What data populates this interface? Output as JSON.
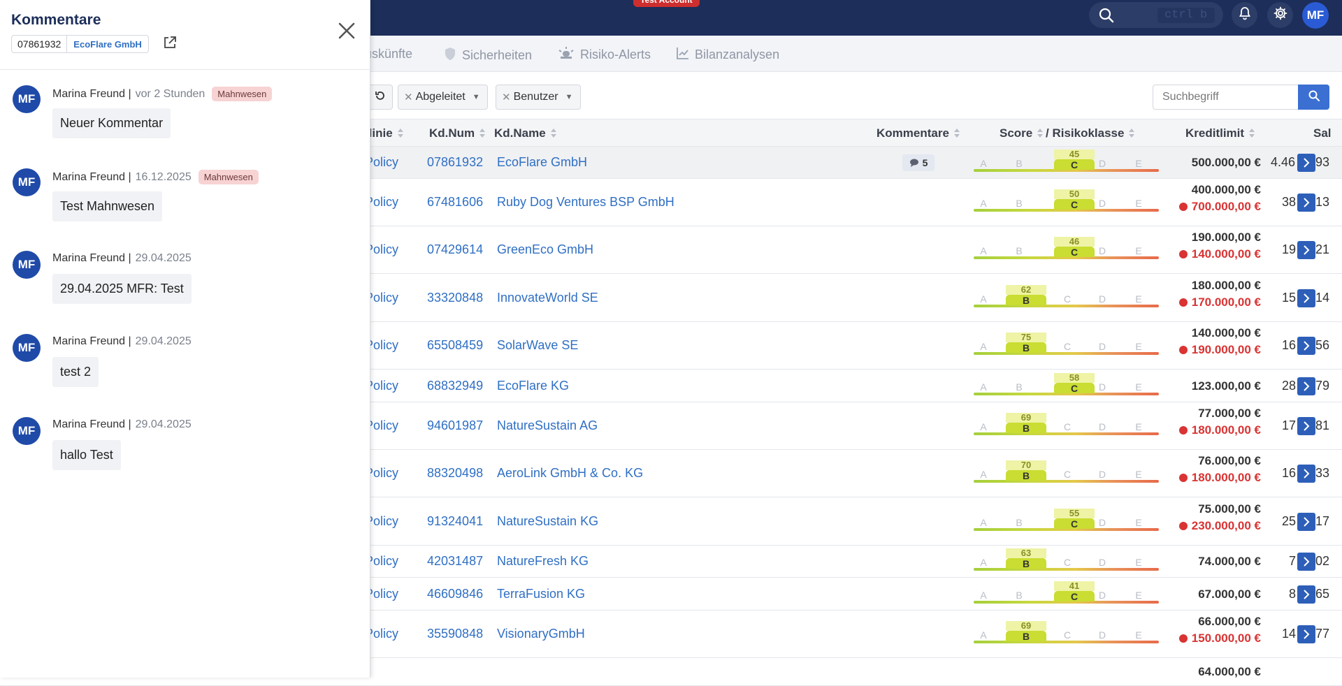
{
  "topbar": {
    "test_badge": "Test Account",
    "search_shortcut": "ctrl  b",
    "user_initials": "MF"
  },
  "subnav": {
    "items": [
      {
        "label": "uskünfte",
        "icon": "document-icon"
      },
      {
        "label": "Sicherheiten",
        "icon": "shield-icon"
      },
      {
        "label": "Risiko-Alerts",
        "icon": "alarm-icon"
      },
      {
        "label": "Bilanzanalysen",
        "icon": "chart-line-icon"
      }
    ]
  },
  "filters": {
    "chips": [
      "Abgeleitet",
      "Benutzer"
    ],
    "search_placeholder": "Suchbegriff"
  },
  "table": {
    "headers": {
      "richtlinie": "tlinie",
      "kdnum": "Kd.Num",
      "kdname": "Kd.Name",
      "kommentare": "Kommentare",
      "score": "Score",
      "risikoklasse": "/ Risikoklasse",
      "kreditlimit": "Kreditlimit",
      "saldo": "Sal"
    },
    "rows": [
      {
        "policy": "Policy",
        "kdnum": "07861932",
        "kdname": "EcoFlare GmbH",
        "comments": "5",
        "score": 45,
        "class": "C",
        "limit": "500.000,00 €",
        "limit_red": "",
        "saldo": "4.46",
        "saldo_tail": "93"
      },
      {
        "policy": "Policy",
        "kdnum": "67481606",
        "kdname": "Ruby Dog Ventures BSP GmbH",
        "comments": "",
        "score": 50,
        "class": "C",
        "limit": "400.000,00 €",
        "limit_red": "700.000,00 €",
        "saldo": "38",
        "saldo_tail": "13"
      },
      {
        "policy": "Policy",
        "kdnum": "07429614",
        "kdname": "GreenEco GmbH",
        "comments": "",
        "score": 46,
        "class": "C",
        "limit": "190.000,00 €",
        "limit_red": "140.000,00 €",
        "saldo": "19",
        "saldo_tail": "21"
      },
      {
        "policy": "Policy",
        "kdnum": "33320848",
        "kdname": "InnovateWorld SE",
        "comments": "",
        "score": 62,
        "class": "B",
        "limit": "180.000,00 €",
        "limit_red": "170.000,00 €",
        "saldo": "15",
        "saldo_tail": "14"
      },
      {
        "policy": "Policy",
        "kdnum": "65508459",
        "kdname": "SolarWave SE",
        "comments": "",
        "score": 75,
        "class": "B",
        "limit": "140.000,00 €",
        "limit_red": "190.000,00 €",
        "saldo": "16",
        "saldo_tail": "56"
      },
      {
        "policy": "Policy",
        "kdnum": "68832949",
        "kdname": "EcoFlare KG",
        "comments": "",
        "score": 58,
        "class": "C",
        "limit": "123.000,00 €",
        "limit_red": "",
        "saldo": "28",
        "saldo_tail": "79"
      },
      {
        "policy": "Policy",
        "kdnum": "94601987",
        "kdname": "NatureSustain AG",
        "comments": "",
        "score": 69,
        "class": "B",
        "limit": "77.000,00 €",
        "limit_red": "180.000,00 €",
        "saldo": "17",
        "saldo_tail": "81"
      },
      {
        "policy": "Policy",
        "kdnum": "88320498",
        "kdname": "AeroLink GmbH & Co. KG",
        "comments": "",
        "score": 70,
        "class": "B",
        "limit": "76.000,00 €",
        "limit_red": "180.000,00 €",
        "saldo": "16",
        "saldo_tail": "33"
      },
      {
        "policy": "Policy",
        "kdnum": "91324041",
        "kdname": "NatureSustain KG",
        "comments": "",
        "score": 55,
        "class": "C",
        "limit": "75.000,00 €",
        "limit_red": "230.000,00 €",
        "saldo": "25",
        "saldo_tail": "17"
      },
      {
        "policy": "Policy",
        "kdnum": "42031487",
        "kdname": "NatureFresh KG",
        "comments": "",
        "score": 63,
        "class": "B",
        "limit": "74.000,00 €",
        "limit_red": "",
        "saldo": "7",
        "saldo_tail": "02"
      },
      {
        "policy": "Policy",
        "kdnum": "46609846",
        "kdname": "TerraFusion KG",
        "comments": "",
        "score": 41,
        "class": "C",
        "limit": "67.000,00 €",
        "limit_red": "",
        "saldo": "8",
        "saldo_tail": "65"
      },
      {
        "policy": "Policy",
        "kdnum": "35590848",
        "kdname": "VisionaryGmbH",
        "comments": "",
        "score": 69,
        "class": "B",
        "limit": "66.000,00 €",
        "limit_red": "150.000,00 €",
        "saldo": "14",
        "saldo_tail": "77"
      },
      {
        "policy": "",
        "kdnum": "",
        "kdname": "",
        "comments": "",
        "score": null,
        "class": "",
        "limit": "64.000,00 €",
        "limit_red": "",
        "saldo": "",
        "saldo_tail": ""
      }
    ],
    "class_letters": [
      "A",
      "B",
      "C",
      "D",
      "E"
    ]
  },
  "panel": {
    "title": "Kommentare",
    "kdnum": "07861932",
    "kdname": "EcoFlare GmbH",
    "comments": [
      {
        "initials": "MF",
        "author": "Marina Freund |",
        "date": "vor 2 Stunden",
        "tag": "Mahnwesen",
        "text": "Neuer Kommentar"
      },
      {
        "initials": "MF",
        "author": "Marina Freund |",
        "date": "16.12.2025",
        "tag": "Mahnwesen",
        "text": "Test Mahnwesen"
      },
      {
        "initials": "MF",
        "author": "Marina Freund |",
        "date": "29.04.2025",
        "tag": "",
        "text": "29.04.2025 MFR: Test"
      },
      {
        "initials": "MF",
        "author": "Marina Freund |",
        "date": "29.04.2025",
        "tag": "",
        "text": "test 2"
      },
      {
        "initials": "MF",
        "author": "Marina Freund |",
        "date": "29.04.2025",
        "tag": "",
        "text": "hallo Test"
      }
    ]
  }
}
